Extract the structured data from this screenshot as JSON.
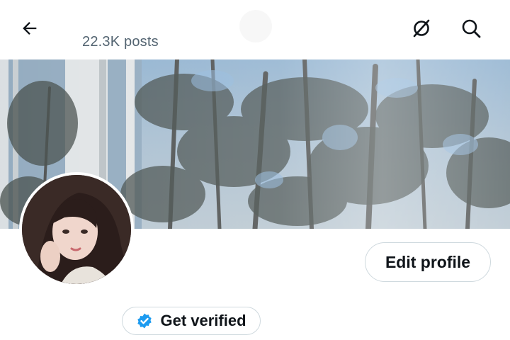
{
  "header": {
    "posts_count": "22.3K posts",
    "back_icon": "arrow-left-icon",
    "grok_icon": "grok-icon",
    "search_icon": "search-icon"
  },
  "banner": {
    "description_icon": "banner-image"
  },
  "profile": {
    "edit_label": "Edit profile",
    "verify_label": "Get verified",
    "verified_color": "#1d9bf0"
  }
}
